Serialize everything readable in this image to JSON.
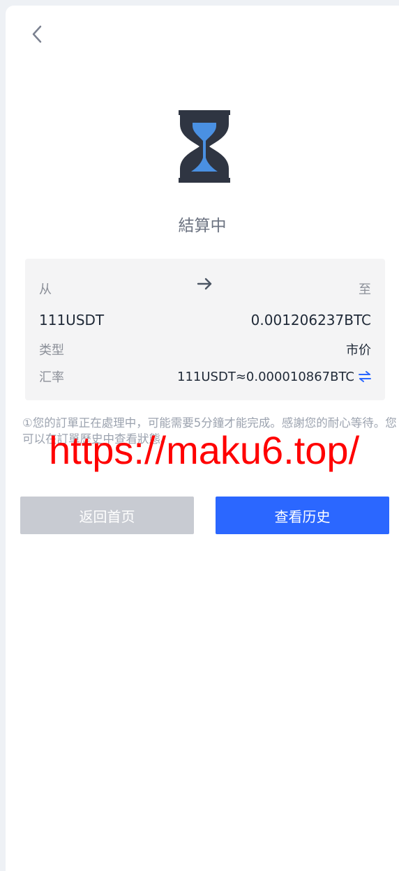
{
  "header": {
    "back_icon": "chevron-left-icon"
  },
  "status": {
    "icon": "hourglass-icon",
    "text": "結算中"
  },
  "order": {
    "from_label": "从",
    "to_label": "至",
    "arrow_icon": "arrow-right-icon",
    "from_amount": "111USDT",
    "to_amount": "0.001206237BTC",
    "type_label": "类型",
    "type_value": "市价",
    "rate_label": "汇率",
    "rate_value": "111USDT≈0.000010867BTC",
    "swap_icon": "swap-icon"
  },
  "note": {
    "text": "①您的訂單正在處理中，可能需要5分鐘才能完成。感謝您的耐心等待。您可以在訂單歷史中查看狀態。"
  },
  "watermark": {
    "text": "https://maku6.top/"
  },
  "buttons": {
    "home_label": "返回首页",
    "history_label": "查看历史"
  },
  "colors": {
    "primary": "#2b67ff",
    "disabled": "#c8cbd2",
    "card_bg": "#f4f4f5",
    "hourglass_dark": "#2f3542",
    "hourglass_sand": "#4a90e2",
    "watermark": "#ff0000"
  }
}
